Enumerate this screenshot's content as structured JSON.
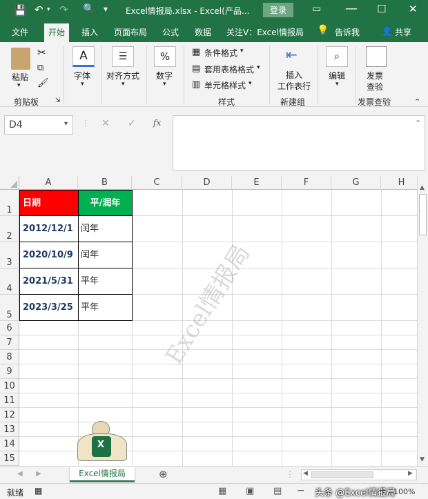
{
  "window": {
    "title": "Excel情报局.xlsx  -  Excel(产品...",
    "login_label": "登录"
  },
  "tabs": [
    "文件",
    "开始",
    "插入",
    "页面布局",
    "公式",
    "数据",
    "关注V：Excel情报局",
    "告诉我",
    "共享"
  ],
  "ribbon": {
    "paste": "粘贴",
    "clipboard_group": "剪贴板",
    "font": "字体",
    "alignment": "对齐方式",
    "number": "数字",
    "conditional_format": "条件格式",
    "table_format": "套用表格格式",
    "cell_style": "单元格样式",
    "styles_group": "样式",
    "insert_row": "插入\n工作表行",
    "new_group": "新建组",
    "edit": "编辑",
    "invoice_check": "发票\n查验",
    "invoice_group": "发票查验"
  },
  "formula_bar": {
    "name_box": "D4",
    "fx": "fx",
    "content": ""
  },
  "grid": {
    "columns": [
      "A",
      "B",
      "C",
      "D",
      "E",
      "F",
      "G",
      "H"
    ],
    "rows": [
      "1",
      "2",
      "3",
      "4",
      "5",
      "6",
      "7",
      "8",
      "9",
      "10",
      "11",
      "12",
      "13",
      "14",
      "15"
    ],
    "header_row": {
      "a": "日期",
      "b": "平/润年"
    },
    "data": [
      {
        "a": "2012/12/1",
        "b": "闰年"
      },
      {
        "a": "2020/10/9",
        "b": "闰年"
      },
      {
        "a": "2021/5/31",
        "b": "平年"
      },
      {
        "a": "2023/3/25",
        "b": "平年"
      }
    ],
    "watermark": "Excel情报局",
    "colors": {
      "header_a": "#ff0000",
      "header_b": "#00b050",
      "date_text": "#1f3864"
    }
  },
  "sheet_tab": "Excel情报局",
  "status": {
    "ready": "就绪",
    "overlay": "头条 @Excel情报局",
    "zoom": "100%"
  }
}
